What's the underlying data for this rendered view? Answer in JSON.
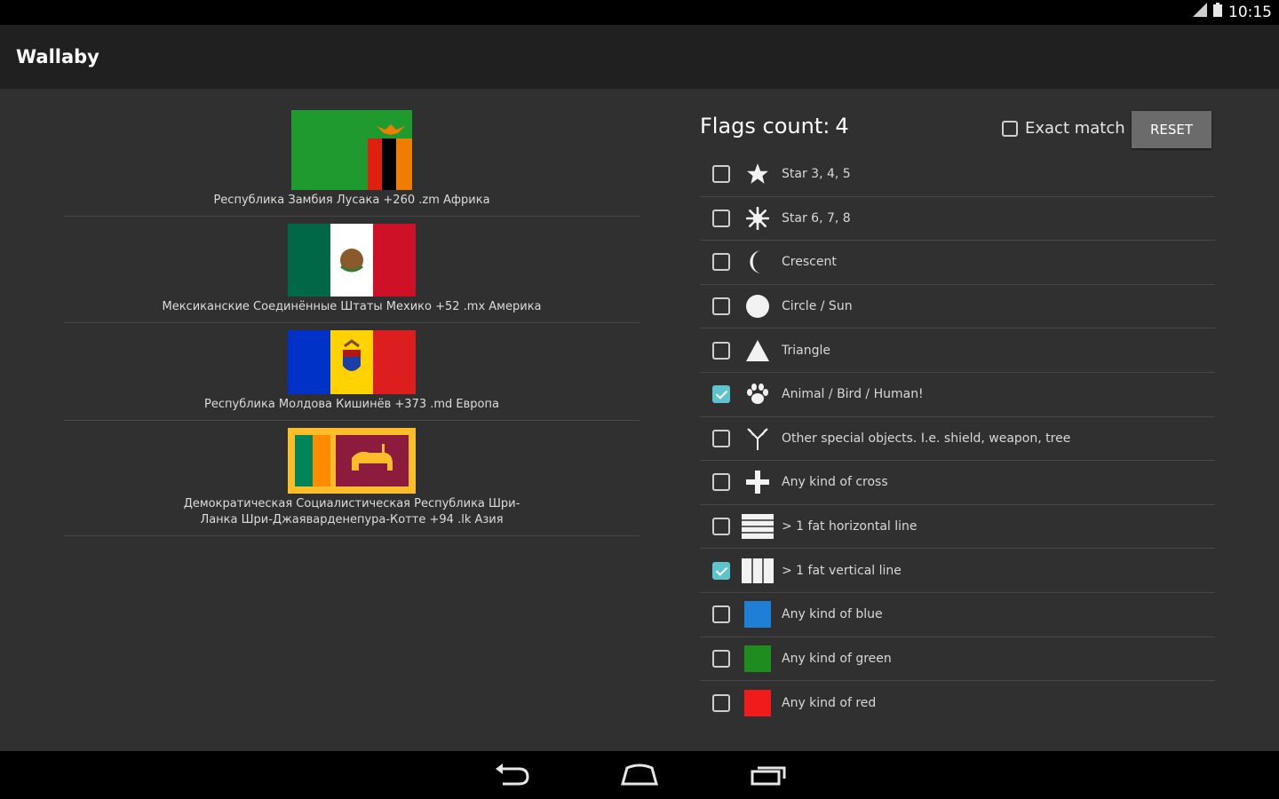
{
  "status": {
    "time": "10:15"
  },
  "app": {
    "title": "Wallaby"
  },
  "countries": [
    {
      "label": "Республика Замбия Лусака +260 .zm Африка"
    },
    {
      "label": "Мексиканские Соединённые Штаты Мехико +52 .mx Америка"
    },
    {
      "label": "Республика Молдова Кишинёв +373 .md Европа"
    },
    {
      "label": "Демократическая Социалистическая Республика Шри-Ланка Шри-Джаявардене­пура-Котте +94 .lk Азия"
    }
  ],
  "filters": {
    "count_label": "Flags count:",
    "count": "4",
    "exact_match_label": "Exact match",
    "exact_match_checked": false,
    "reset_label": "RESET",
    "items": [
      {
        "label": "Star 3, 4, 5",
        "icon": "star-icon",
        "checked": false
      },
      {
        "label": "Star 6, 7, 8",
        "icon": "multi-star-icon",
        "checked": false
      },
      {
        "label": "Crescent",
        "icon": "crescent-icon",
        "checked": false
      },
      {
        "label": "Circle / Sun",
        "icon": "circle-icon",
        "checked": false
      },
      {
        "label": "Triangle",
        "icon": "triangle-icon",
        "checked": false
      },
      {
        "label": "Animal / Bird / Human!",
        "icon": "paw-icon",
        "checked": true
      },
      {
        "label": "Other special objects. I.e. shield, weapon, tree",
        "icon": "special-object-icon",
        "checked": false
      },
      {
        "label": "Any kind of cross",
        "icon": "cross-icon",
        "checked": false
      },
      {
        "label": "> 1 fat horizontal line",
        "icon": "horizontal-lines-icon",
        "checked": false
      },
      {
        "label": "> 1 fat vertical line",
        "icon": "vertical-lines-icon",
        "checked": true
      },
      {
        "label": "Any kind of blue",
        "icon": "blue-swatch-icon",
        "checked": false,
        "color": "#1f7fd6"
      },
      {
        "label": "Any kind of green",
        "icon": "green-swatch-icon",
        "checked": false,
        "color": "#1e8c1e"
      },
      {
        "label": "Any kind of red",
        "icon": "red-swatch-icon",
        "checked": false,
        "color": "#f11b1b"
      }
    ]
  },
  "colors": {
    "accent_checkbox": "#5ec4cc",
    "background": "#303030",
    "actionbar": "#202020"
  }
}
